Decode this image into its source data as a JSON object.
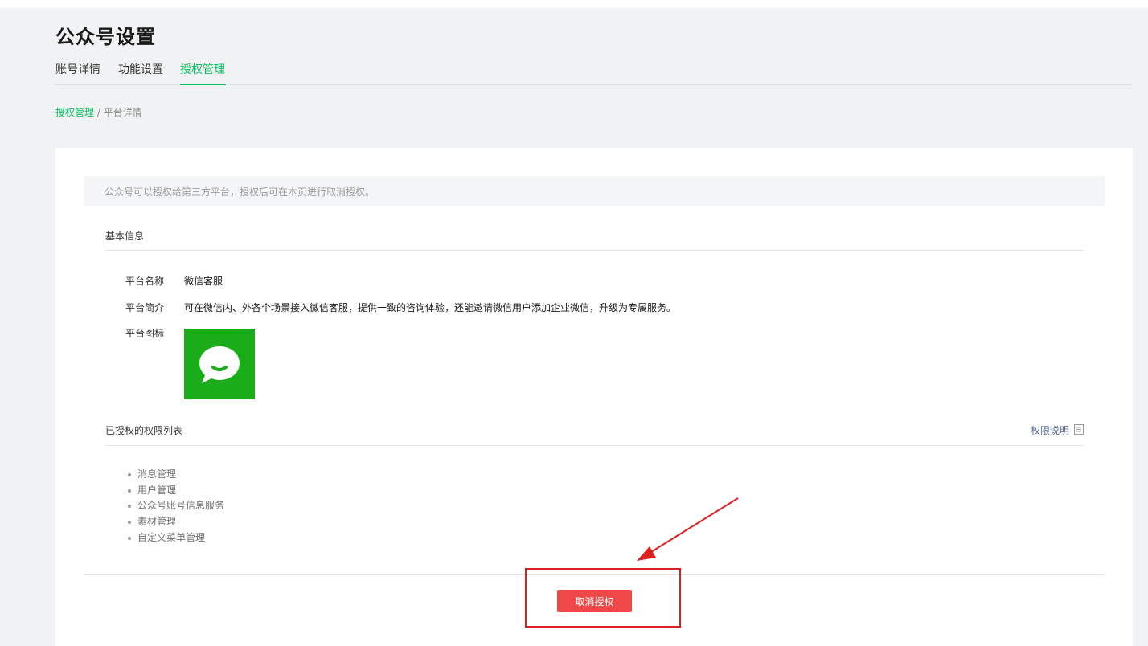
{
  "page": {
    "title": "公众号设置"
  },
  "tabs": [
    {
      "label": "账号详情",
      "active": false
    },
    {
      "label": "功能设置",
      "active": false
    },
    {
      "label": "授权管理",
      "active": true
    }
  ],
  "breadcrumb": {
    "link": "授权管理",
    "separator": " / ",
    "current": "平台详情"
  },
  "tip": "公众号可以授权给第三方平台，授权后可在本页进行取消授权。",
  "basic_info": {
    "title": "基本信息",
    "name_label": "平台名称",
    "name_value": "微信客服",
    "desc_label": "平台简介",
    "desc_value": "可在微信内、外各个场景接入微信客服，提供一致的咨询体验，还能邀请微信用户添加企业微信，升级为专属服务。",
    "icon_label": "平台图标",
    "icon": "wechat-kefu-chat-bubble-icon"
  },
  "permissions": {
    "title": "已授权的权限列表",
    "help_link": "权限说明",
    "help_icon": "document-icon",
    "items": [
      "消息管理",
      "用户管理",
      "公众号账号信息服务",
      "素材管理",
      "自定义菜单管理"
    ]
  },
  "actions": {
    "cancel_label": "取消授权"
  },
  "colors": {
    "accent": "#07c160",
    "danger": "#f04848",
    "icon_bg": "#1aad19",
    "annotation": "#e02020"
  }
}
